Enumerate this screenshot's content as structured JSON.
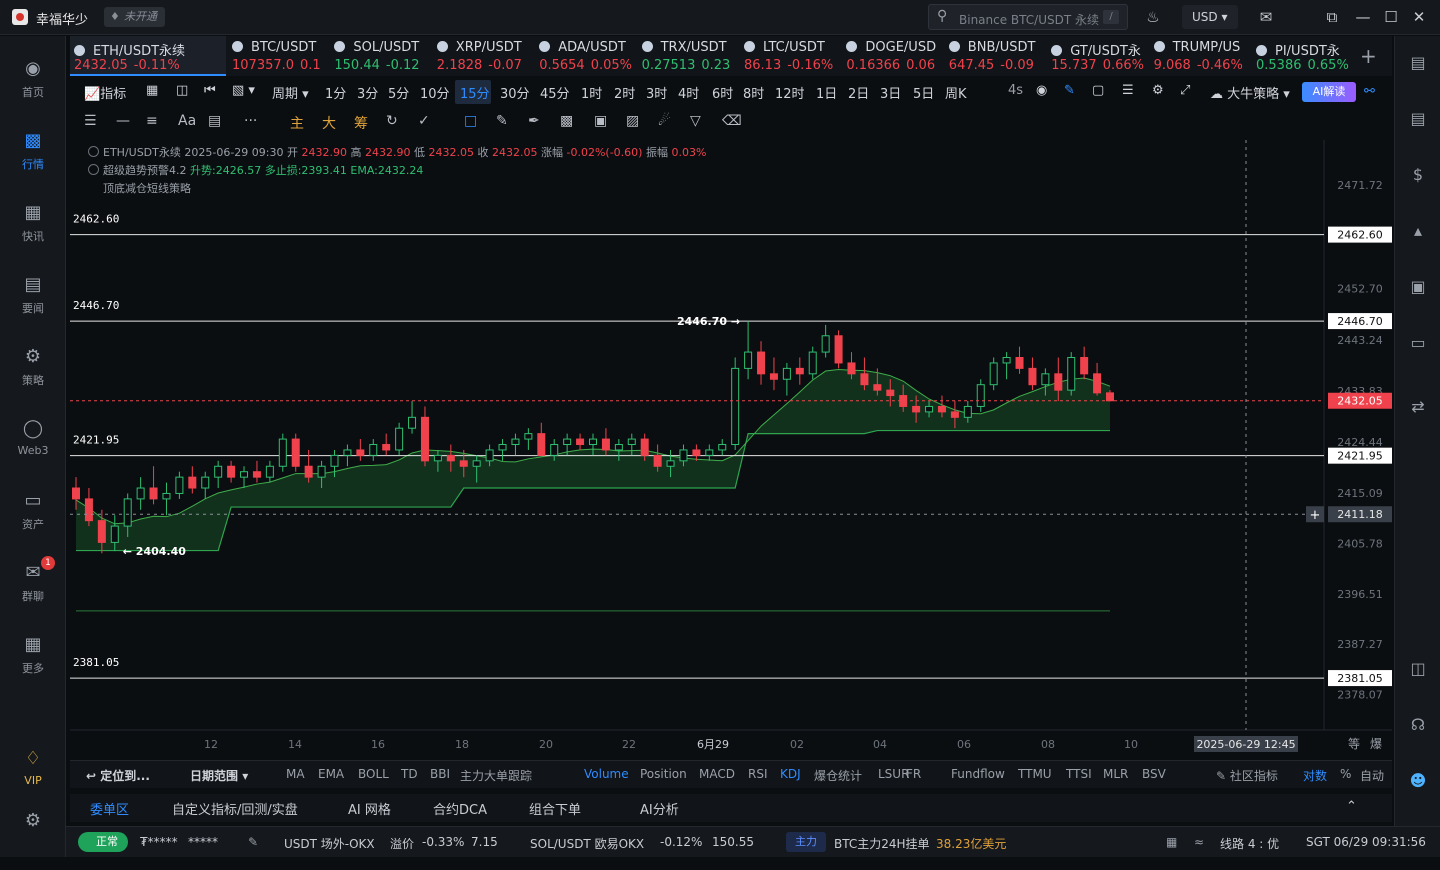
{
  "topbar": {
    "username": "幸福华少",
    "not_open": "未开通",
    "search_placeholder": "Binance BTC/USDT 永续",
    "search_shortcut": "/",
    "currency": "USD"
  },
  "sidebar": [
    {
      "label": "首页",
      "icon": "home-icon"
    },
    {
      "label": "行情",
      "icon": "market-chart-icon",
      "active": true
    },
    {
      "label": "快讯",
      "icon": "flash-news-icon"
    },
    {
      "label": "要闻",
      "icon": "news-icon"
    },
    {
      "label": "策略",
      "icon": "strategy-icon"
    },
    {
      "label": "Web3",
      "icon": "web3-icon"
    },
    {
      "label": "资产",
      "icon": "wallet-icon"
    },
    {
      "label": "群聊",
      "icon": "chat-icon",
      "badge": "1"
    },
    {
      "label": "更多",
      "icon": "more-grid-icon"
    },
    {
      "label": "VIP",
      "icon": "vip-diamond-icon"
    }
  ],
  "tickers": [
    {
      "name": "ETH/USDT永续",
      "price": "2432.05",
      "change": "-0.11%",
      "dir": "dn",
      "active": true
    },
    {
      "name": "BTC/USDT",
      "price": "107357.0",
      "change": "0.1",
      "dir": "dn"
    },
    {
      "name": "SOL/USDT",
      "price": "150.44",
      "change": "-0.12",
      "dir": "up"
    },
    {
      "name": "XRP/USDT",
      "price": "2.1828",
      "change": "-0.07",
      "dir": "dn"
    },
    {
      "name": "ADA/USDT",
      "price": "0.5654",
      "change": "0.05%",
      "dir": "dn"
    },
    {
      "name": "TRX/USDT",
      "price": "0.27513",
      "change": "0.23",
      "dir": "up"
    },
    {
      "name": "LTC/USDT",
      "price": "86.13",
      "change": "-0.16%",
      "dir": "dn"
    },
    {
      "name": "DOGE/USD",
      "price": "0.16366",
      "change": "0.06",
      "dir": "dn"
    },
    {
      "name": "BNB/USDT",
      "price": "647.45",
      "change": "-0.09",
      "dir": "dn"
    },
    {
      "name": "GT/USDT永",
      "price": "15.737",
      "change": "0.66%",
      "dir": "dn"
    },
    {
      "name": "TRUMP/US",
      "price": "9.068",
      "change": "-0.46%",
      "dir": "dn"
    },
    {
      "name": "PI/USDT永",
      "price": "0.5386",
      "change": "0.65%",
      "dir": "up"
    }
  ],
  "toolbar": {
    "indicator": "指标",
    "period": "周期",
    "intervals": [
      "1分",
      "3分",
      "5分",
      "10分",
      "15分",
      "30分",
      "45分",
      "1时",
      "2时",
      "3时",
      "4时",
      "6时",
      "8时",
      "12时",
      "1日",
      "2日",
      "3日",
      "5日",
      "周K"
    ],
    "selected_interval": "15分",
    "refresh": "4s",
    "strategy": "大牛策略",
    "ai": "AI解读"
  },
  "drawtools": [
    "主",
    "大",
    "筹"
  ],
  "chart_info": {
    "line1": "ETH/USDT永续  2025-06-29 09:30  开",
    "open": "2432.90",
    "high_label": "高",
    "high": "2432.90",
    "low_label": "低",
    "low": "2432.05",
    "close_label": "收",
    "close": "2432.05",
    "chg_label": "涨幅",
    "chg": "-0.02%(-0.60)",
    "amp_label": "振幅",
    "amp": "0.03%",
    "line2_name": "超级趋势预警4.2",
    "line2_vals": "升势:2426.57  多止损:2393.41  EMA:2432.24",
    "line3": "顶底减仓短线策略"
  },
  "chart_data": {
    "type": "candlestick",
    "y_axis_ticks": [
      2471.72,
      2452.7,
      2443.24,
      2433.83,
      2424.44,
      2415.09,
      2405.78,
      2396.51,
      2387.27,
      2378.07
    ],
    "ylim": [
      2371.5,
      2480.0
    ],
    "level_lines": [
      2462.6,
      2446.7,
      2421.95,
      2381.05
    ],
    "current_price": 2432.05,
    "crosshair_price": 2411.18,
    "x_ticks": [
      "12",
      "14",
      "16",
      "18",
      "20",
      "22",
      "6月29",
      "02",
      "04",
      "06",
      "08",
      "10"
    ],
    "crosshair_time": "2025-06-29 12:45",
    "annotations": [
      {
        "text": "2446.70"
      },
      {
        "text": "2404.40"
      }
    ],
    "candles": [
      [
        2416,
        2418,
        2412,
        2414
      ],
      [
        2414,
        2416,
        2409,
        2410
      ],
      [
        2410,
        2412,
        2404,
        2406
      ],
      [
        2406,
        2411,
        2404.4,
        2409
      ],
      [
        2409,
        2415,
        2407,
        2414
      ],
      [
        2414,
        2418,
        2412,
        2416
      ],
      [
        2416,
        2420,
        2413,
        2414
      ],
      [
        2414,
        2417,
        2411,
        2415
      ],
      [
        2415,
        2419,
        2414,
        2418
      ],
      [
        2418,
        2420,
        2415,
        2416
      ],
      [
        2416,
        2419,
        2414,
        2418
      ],
      [
        2418,
        2421,
        2416,
        2420
      ],
      [
        2420,
        2421,
        2417,
        2418
      ],
      [
        2418,
        2420,
        2416,
        2419
      ],
      [
        2419,
        2421,
        2417,
        2418
      ],
      [
        2418,
        2421,
        2417,
        2420
      ],
      [
        2420,
        2426,
        2419,
        2425
      ],
      [
        2425,
        2426,
        2419,
        2420
      ],
      [
        2420,
        2423,
        2417,
        2418
      ],
      [
        2418,
        2421,
        2416,
        2420
      ],
      [
        2420,
        2423,
        2418,
        2422
      ],
      [
        2422,
        2424,
        2420,
        2423
      ],
      [
        2423,
        2425,
        2421,
        2422
      ],
      [
        2422,
        2425,
        2421,
        2424
      ],
      [
        2424,
        2426,
        2422,
        2423
      ],
      [
        2423,
        2428,
        2422,
        2427
      ],
      [
        2427,
        2432,
        2426,
        2429
      ],
      [
        2429,
        2431,
        2420,
        2421
      ],
      [
        2421,
        2423,
        2419,
        2422
      ],
      [
        2422,
        2424,
        2419,
        2421
      ],
      [
        2421,
        2423,
        2418,
        2420
      ],
      [
        2420,
        2422,
        2417,
        2421
      ],
      [
        2421,
        2424,
        2420,
        2423
      ],
      [
        2423,
        2425,
        2421,
        2424
      ],
      [
        2424,
        2426,
        2422,
        2425
      ],
      [
        2425,
        2427,
        2423,
        2426
      ],
      [
        2426,
        2428,
        2424,
        2422
      ],
      [
        2422,
        2425,
        2421,
        2424
      ],
      [
        2424,
        2426,
        2422,
        2425
      ],
      [
        2425,
        2426,
        2423,
        2424
      ],
      [
        2424,
        2426,
        2422,
        2425
      ],
      [
        2425,
        2427,
        2422,
        2423
      ],
      [
        2423,
        2425,
        2421,
        2424
      ],
      [
        2424,
        2426,
        2422,
        2425
      ],
      [
        2425,
        2426,
        2421,
        2422
      ],
      [
        2422,
        2424,
        2419,
        2420
      ],
      [
        2420,
        2423,
        2418,
        2421
      ],
      [
        2421,
        2424,
        2420,
        2423
      ],
      [
        2423,
        2424,
        2421,
        2422
      ],
      [
        2422,
        2424,
        2421,
        2423
      ],
      [
        2423,
        2425,
        2422,
        2424
      ],
      [
        2424,
        2440,
        2423,
        2438
      ],
      [
        2438,
        2446.7,
        2436,
        2441
      ],
      [
        2441,
        2443,
        2435,
        2437
      ],
      [
        2437,
        2440,
        2434,
        2436
      ],
      [
        2436,
        2439,
        2433,
        2438
      ],
      [
        2438,
        2440,
        2435,
        2437
      ],
      [
        2437,
        2442,
        2436,
        2441
      ],
      [
        2441,
        2446,
        2440,
        2444
      ],
      [
        2444,
        2445,
        2438,
        2439
      ],
      [
        2439,
        2441,
        2436,
        2437
      ],
      [
        2437,
        2440,
        2434,
        2435
      ],
      [
        2435,
        2438,
        2433,
        2434
      ],
      [
        2434,
        2436,
        2431,
        2433
      ],
      [
        2433,
        2435,
        2430,
        2431
      ],
      [
        2431,
        2433,
        2428,
        2430
      ],
      [
        2430,
        2432,
        2429,
        2431
      ],
      [
        2431,
        2433,
        2429,
        2430
      ],
      [
        2430,
        2432,
        2427,
        2429
      ],
      [
        2429,
        2432,
        2428,
        2431
      ],
      [
        2431,
        2436,
        2430,
        2435
      ],
      [
        2435,
        2440,
        2434,
        2439
      ],
      [
        2439,
        2441,
        2436,
        2440
      ],
      [
        2440,
        2442,
        2437,
        2438
      ],
      [
        2438,
        2440,
        2434,
        2435
      ],
      [
        2435,
        2438,
        2433,
        2437
      ],
      [
        2437,
        2440,
        2432,
        2434
      ],
      [
        2434,
        2441,
        2433,
        2440
      ],
      [
        2440,
        2442,
        2436,
        2437
      ],
      [
        2437,
        2439,
        2433,
        2433.5
      ],
      [
        2433.5,
        2434,
        2432,
        2432.05
      ]
    ]
  },
  "indicator_bar": {
    "locate": "定位到...",
    "date_range": "日期范围",
    "indicators": [
      "MA",
      "EMA",
      "BOLL",
      "TD",
      "BBI",
      "主力大单跟踪",
      "Volume",
      "Position",
      "MACD",
      "RSI",
      "KDJ",
      "爆仓统计",
      "LSUR",
      "FR",
      "Fundflow",
      "TTMU",
      "TTSI",
      "MLR",
      "BSV"
    ],
    "selected": [
      "Volume",
      "KDJ"
    ],
    "community": "社区指标",
    "log": "对数",
    "percent": "%",
    "auto": "自动",
    "equal": "等",
    "burst": "爆"
  },
  "bottom_tabs": [
    "委单区",
    "自定义指标/回测/实盘",
    "AI 网格",
    "合约DCA",
    "组合下单",
    "AI分析"
  ],
  "statusbar": {
    "normal": "正常",
    "masked1": "₮*****",
    "masked2": "*****",
    "usdt_label": "USDT 场外-OKX",
    "usdt_premium_label": "溢价",
    "usdt_premium": "-0.33%",
    "usdt_price": "7.15",
    "sol_label": "SOL/USDT 欧易OKX",
    "sol_change": "-0.12%",
    "sol_price": "150.55",
    "main_force": "主力",
    "btc_orders_label": "BTC主力24H挂单",
    "btc_orders": "38.23亿美元",
    "line": "线路 4 : 优",
    "time": "SGT 06/29 09:31:56"
  },
  "colors": {
    "up": "#2fbf71",
    "down": "#f0424c",
    "accent": "#2f8cff",
    "bg": "#0b0e11"
  }
}
